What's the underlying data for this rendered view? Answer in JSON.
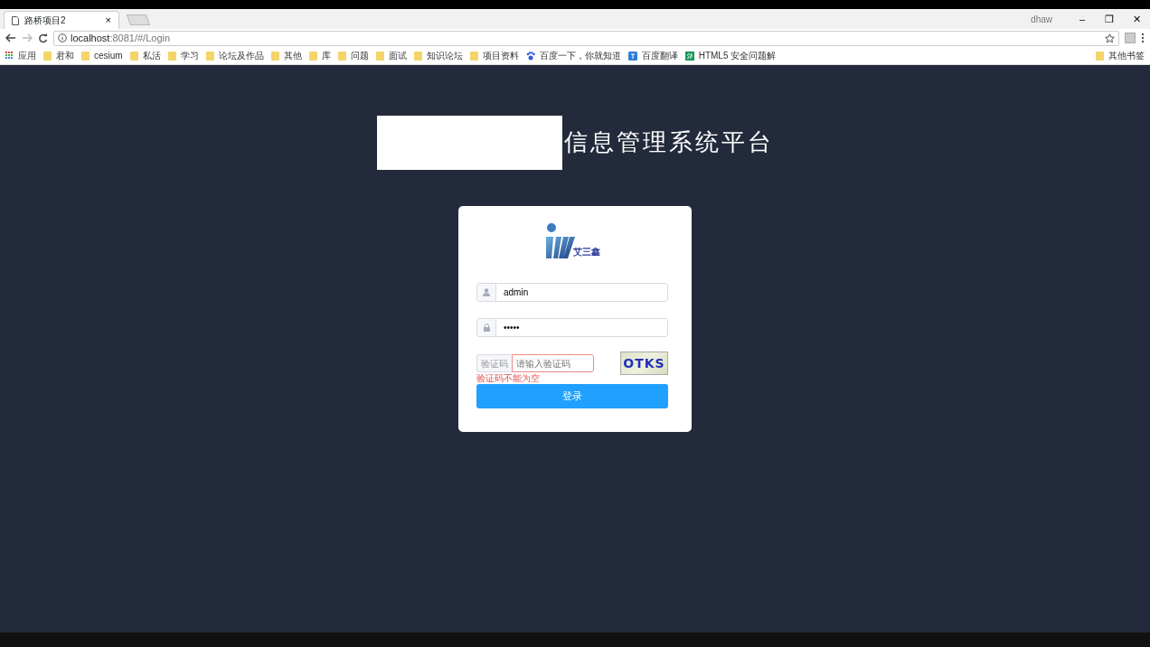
{
  "browser": {
    "tab": {
      "title": "路桥项目2",
      "close": "×"
    },
    "profile": "dhaw",
    "window_controls": [
      "–",
      "❐",
      "✕"
    ],
    "address": {
      "host": "localhost",
      "rest": ":8081/#/Login"
    },
    "bookmarks": [
      {
        "kind": "apps",
        "label": "应用"
      },
      {
        "kind": "folder",
        "label": "君和"
      },
      {
        "kind": "folder",
        "label": "cesium"
      },
      {
        "kind": "folder",
        "label": "私活"
      },
      {
        "kind": "folder",
        "label": "学习"
      },
      {
        "kind": "folder",
        "label": "论坛及作品"
      },
      {
        "kind": "folder",
        "label": "其他"
      },
      {
        "kind": "folder",
        "label": "库"
      },
      {
        "kind": "folder",
        "label": "问题"
      },
      {
        "kind": "folder",
        "label": "面试"
      },
      {
        "kind": "folder",
        "label": "知识论坛"
      },
      {
        "kind": "folder",
        "label": "项目资料"
      },
      {
        "kind": "paw",
        "label": "百度一下，你就知道"
      },
      {
        "kind": "translate",
        "label": "百度翻译"
      },
      {
        "kind": "sf",
        "label": "HTML5 安全问题解"
      }
    ],
    "other_bookmarks": "其他书签"
  },
  "page": {
    "title": "信息管理系统平台",
    "login": {
      "logo_text": "艾三鑫",
      "username": {
        "value": "admin"
      },
      "password": {
        "value": "•••••"
      },
      "captcha": {
        "label": "验证码",
        "placeholder": "请输入验证码",
        "code": "OTKS",
        "error": "验证码不能为空",
        "invalid": true
      },
      "submit": "登录"
    }
  }
}
